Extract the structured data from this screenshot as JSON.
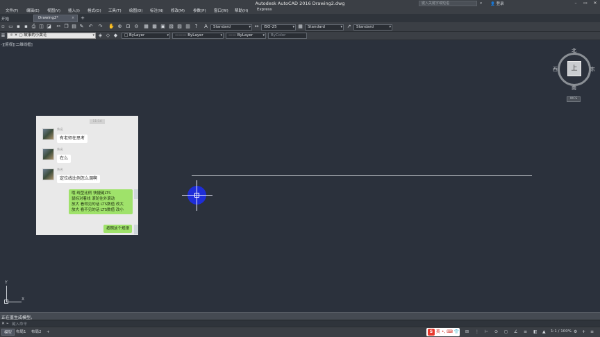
{
  "title": "Autodesk AutoCAD 2016    Drawing2.dwg",
  "search": {
    "placeholder": "键入关键字或短语"
  },
  "user": "登录",
  "menu": [
    "文件(F)",
    "编辑(E)",
    "视图(V)",
    "插入(I)",
    "格式(O)",
    "工具(T)",
    "绘图(D)",
    "标注(N)",
    "修改(M)",
    "参数(P)",
    "窗口(W)",
    "帮助(H)",
    "Express"
  ],
  "tabs": {
    "start": "开始",
    "active": "Drawing2*",
    "close": "×",
    "add": "+"
  },
  "toolbar1": {
    "textstyle": "Standard",
    "dimstyle": "ISO-25",
    "tablestyle": "Standard",
    "mleaderstyle": "Standard"
  },
  "toolbar2": {
    "layer": "故事的小黄花",
    "color": "ByLayer",
    "linetype": "ByLayer",
    "lineweight": "ByLayer",
    "plotstyle": "ByColor"
  },
  "viewport_label": "-][俯视][二维线框]",
  "viewcube": {
    "top": "上",
    "north": "北",
    "south": "南",
    "west": "西",
    "east": "东",
    "wcs": "WCS"
  },
  "chat": {
    "badge": "11:14",
    "messages_left": [
      {
        "nick": "佚名",
        "text": "有老师在思考"
      },
      {
        "nick": "佚名",
        "text": "在么"
      },
      {
        "nick": "佚名",
        "text": "定位线比例怎么调啊"
      }
    ],
    "reply_lines": [
      "哦 线型比例 快捷键LTS",
      "鼠标对着线 滚轮往外滚动",
      "放大 看得见的话 LTS数值 改大",
      "放大 看不见的话 LTS数值 改小"
    ],
    "reply2": "按照这个规律"
  },
  "ucs": {
    "x": "X",
    "y": "Y"
  },
  "command_history": "正在重生成模型。",
  "command_input": {
    "placeholder": "键入命令"
  },
  "status_tabs": [
    "模型",
    "布局1",
    "布局2"
  ],
  "ime": {
    "logo": "S",
    "text": "英 •, ⌨ 👕"
  },
  "zoom": "1:1 / 100%"
}
